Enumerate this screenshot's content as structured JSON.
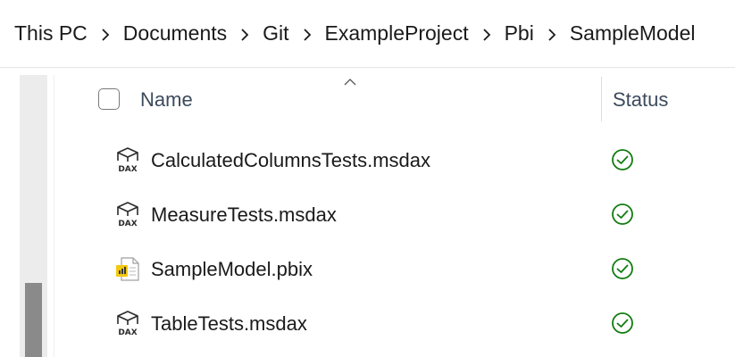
{
  "breadcrumb": {
    "items": [
      "This PC",
      "Documents",
      "Git",
      "ExampleProject",
      "Pbi",
      "SampleModel"
    ]
  },
  "columns": {
    "name": "Name",
    "status": "Status"
  },
  "files": [
    {
      "name": "CalculatedColumnsTests.msdax",
      "icon": "dax-file-icon",
      "status": "synced"
    },
    {
      "name": "MeasureTests.msdax",
      "icon": "dax-file-icon",
      "status": "synced"
    },
    {
      "name": "SampleModel.pbix",
      "icon": "pbix-file-icon",
      "status": "synced"
    },
    {
      "name": "TableTests.msdax",
      "icon": "dax-file-icon",
      "status": "synced"
    }
  ],
  "colors": {
    "status_ok": "#107c10",
    "pbix_accent": "#f2c811"
  }
}
